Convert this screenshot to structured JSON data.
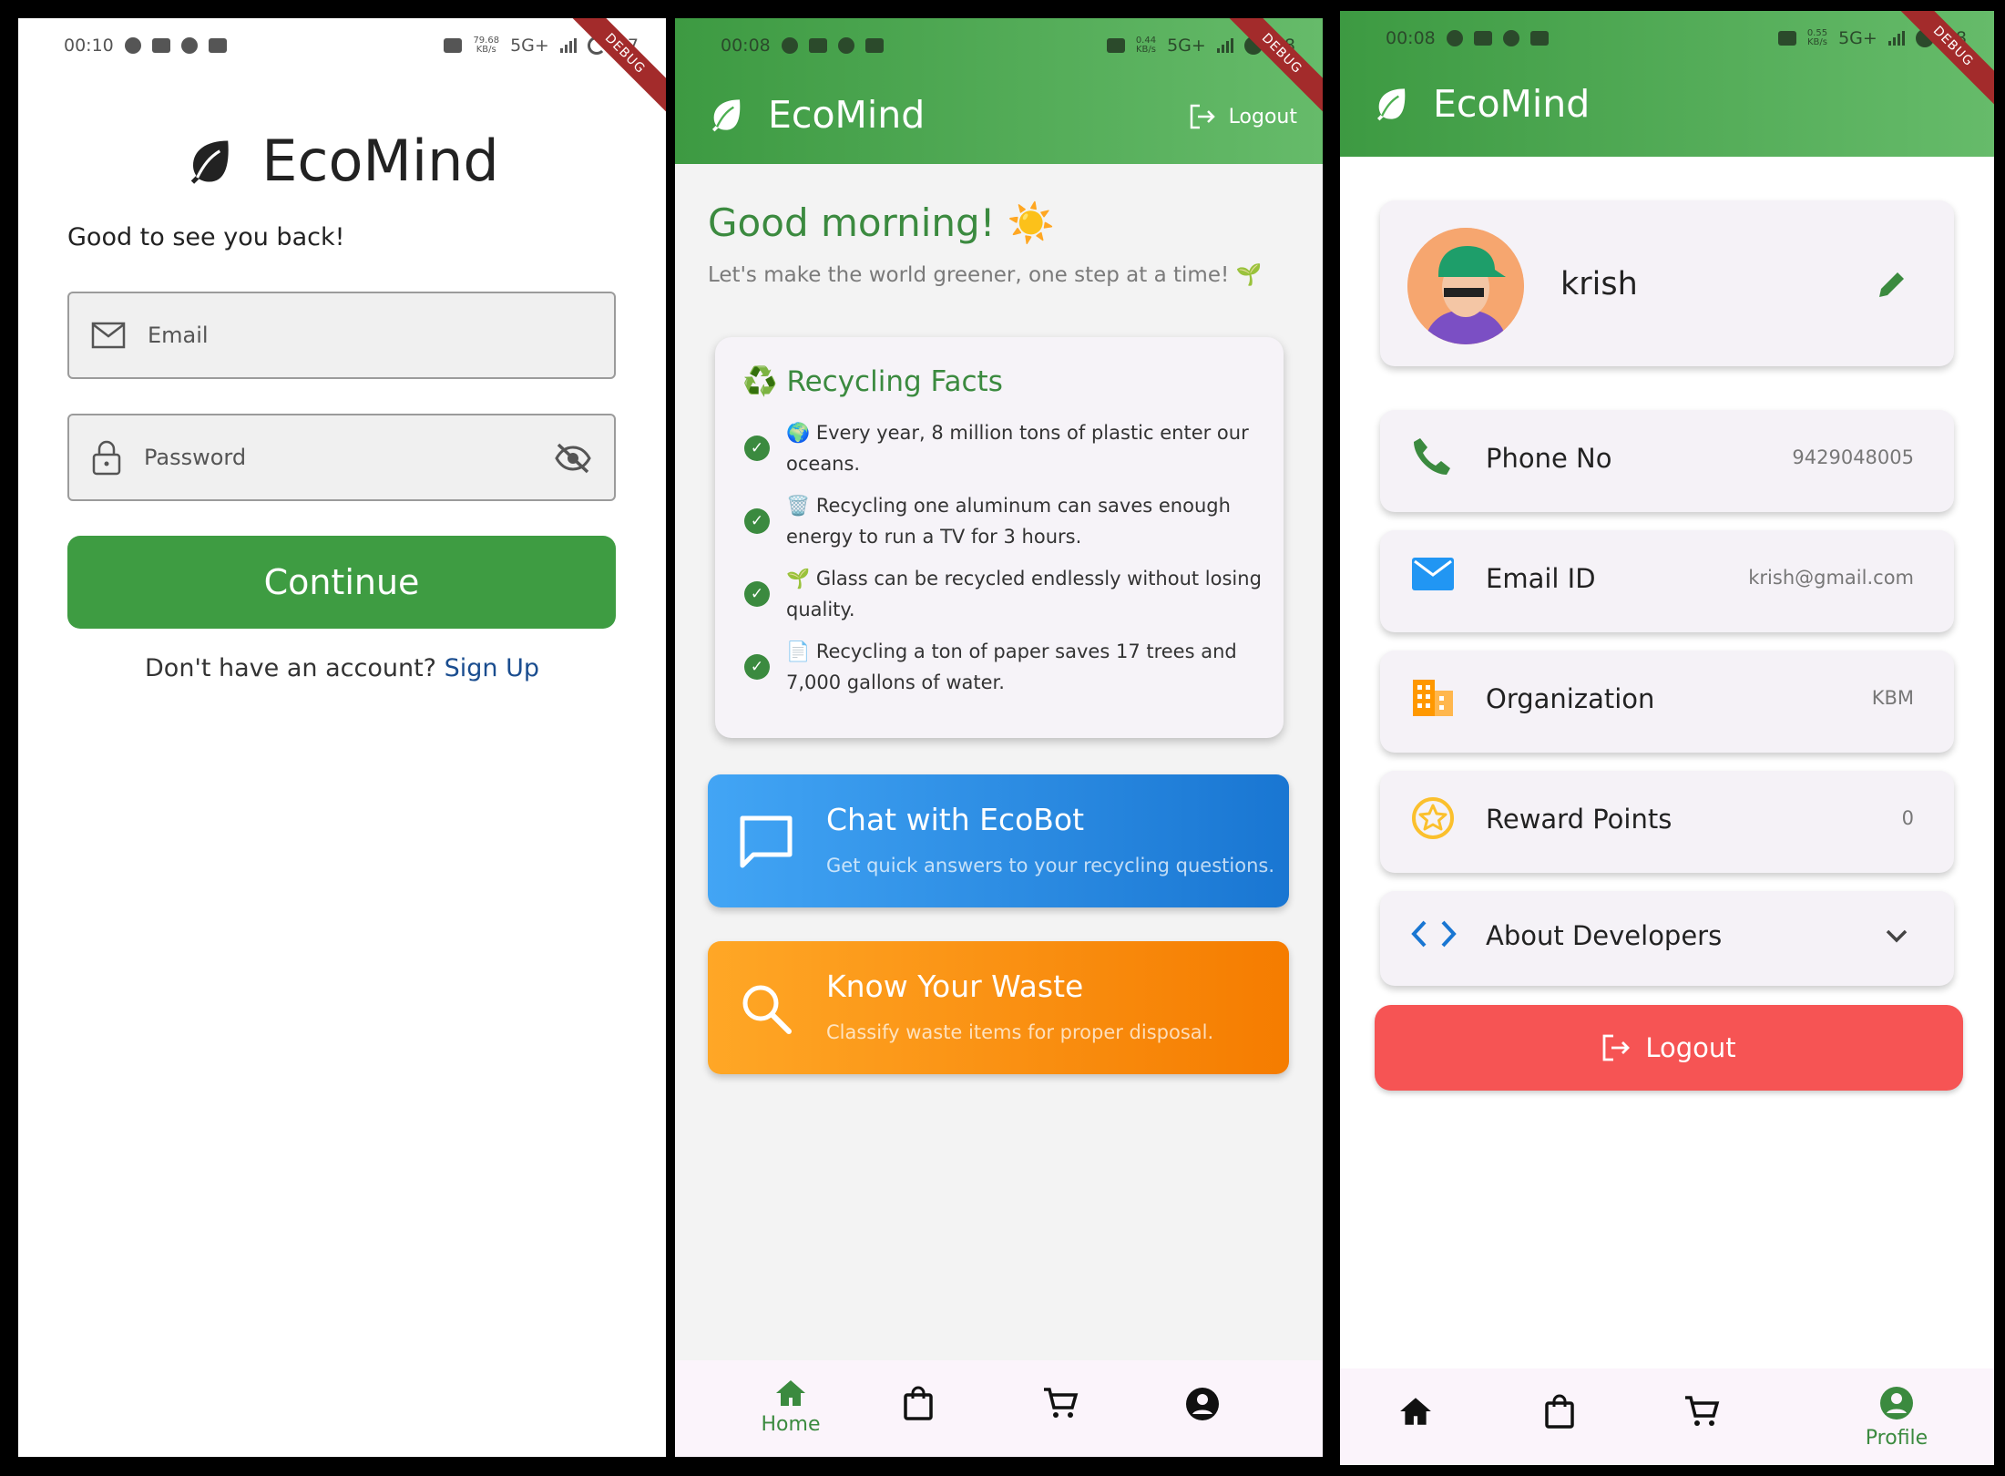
{
  "login": {
    "status_time": "00:10",
    "status_net": "79.68\nKB/s",
    "status_label": "5G+",
    "battery": "57",
    "debug": "DEBUG",
    "brand": "EcoMind",
    "welcome": "Good to see you back!",
    "email_placeholder": "Email",
    "password_placeholder": "Password",
    "continue_label": "Continue",
    "no_account": "Don't have an account?",
    "signup_label": "Sign Up"
  },
  "home": {
    "status_time": "00:08",
    "status_net": "0.44\nKB/s",
    "status_label": "5G+",
    "battery": "58",
    "debug": "DEBUG",
    "brand": "EcoMind",
    "logout_label": "Logout",
    "greeting": "Good morning! ☀️",
    "subtitle": "Let's make the world greener, one step at a time! 🌱",
    "facts_title": "♻️ Recycling Facts",
    "facts": [
      "🌍 Every year, 8 million tons of plastic enter our oceans.",
      "🗑️ Recycling one aluminum can saves enough energy to run a TV for 3 hours.",
      "🌱 Glass can be recycled endlessly without losing quality.",
      "📄 Recycling a ton of paper saves 17 trees and 7,000 gallons of water."
    ],
    "chat_title": "Chat with EcoBot",
    "chat_desc": "Get quick answers to your recycling questions.",
    "waste_title": "Know Your Waste",
    "waste_desc": "Classify waste items for proper disposal.",
    "nav_home_label": "Home"
  },
  "profile": {
    "status_time": "00:08",
    "status_net": "0.55\nKB/s",
    "status_label": "5G+",
    "battery": "58",
    "debug": "DEBUG",
    "brand": "EcoMind",
    "username": "krish",
    "rows": {
      "phone_label": "Phone No",
      "phone_value": "9429048005",
      "email_label": "Email ID",
      "email_value": "krish@gmail.com",
      "org_label": "Organization",
      "org_value": "KBM",
      "reward_label": "Reward Points",
      "reward_value": "0",
      "about_label": "About Developers"
    },
    "logout_label": "Logout",
    "nav_profile_label": "Profile"
  },
  "colors": {
    "primary_green": "#3d9a42",
    "chat_blue": "#1976d2",
    "waste_orange": "#f57c00",
    "logout_red": "#f65454"
  }
}
